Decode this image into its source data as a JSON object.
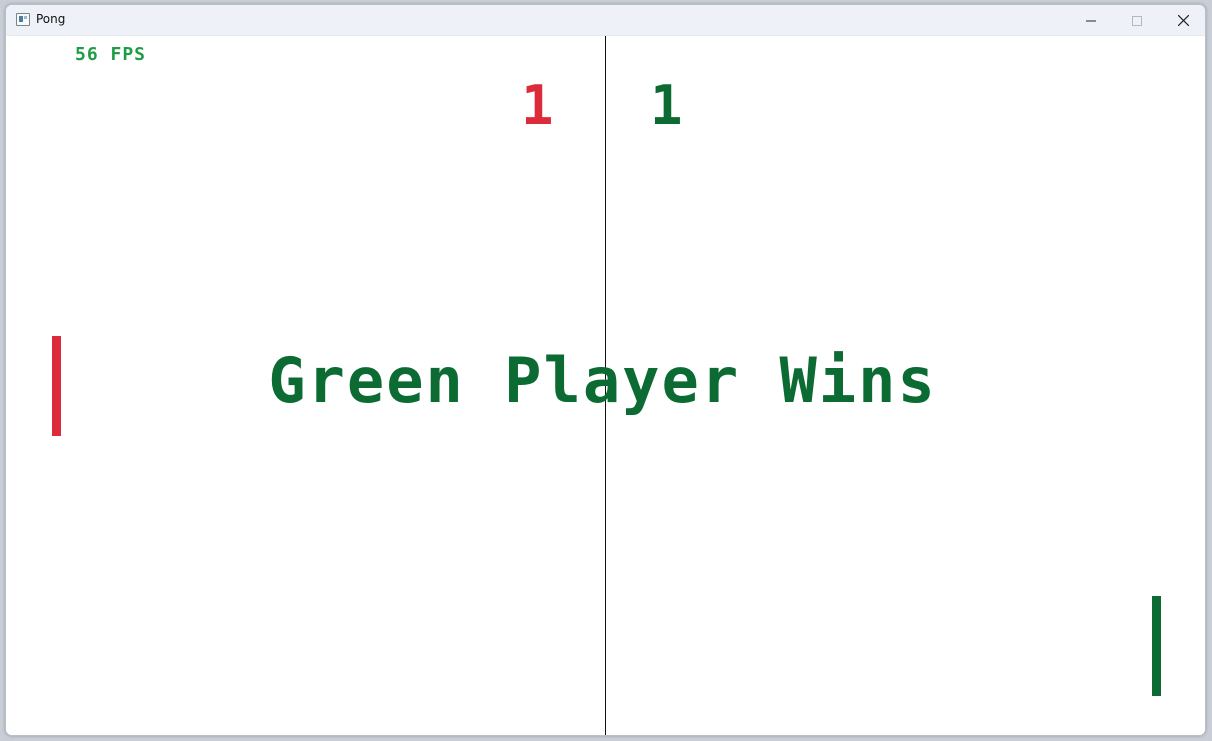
{
  "window": {
    "title": "Pong"
  },
  "game": {
    "fps": "56 FPS",
    "score_red": "1",
    "score_green": "1",
    "message": "Green Player Wins"
  },
  "icons": {
    "app": "app-window-icon",
    "minimize": "minimize-icon",
    "maximize": "maximize-icon",
    "close": "close-icon"
  },
  "colors": {
    "red_player": "#dc2b3b",
    "green_player": "#0c6b32",
    "fps_text": "#1f9d46",
    "center_line": "#111111",
    "background": "#ffffff"
  }
}
